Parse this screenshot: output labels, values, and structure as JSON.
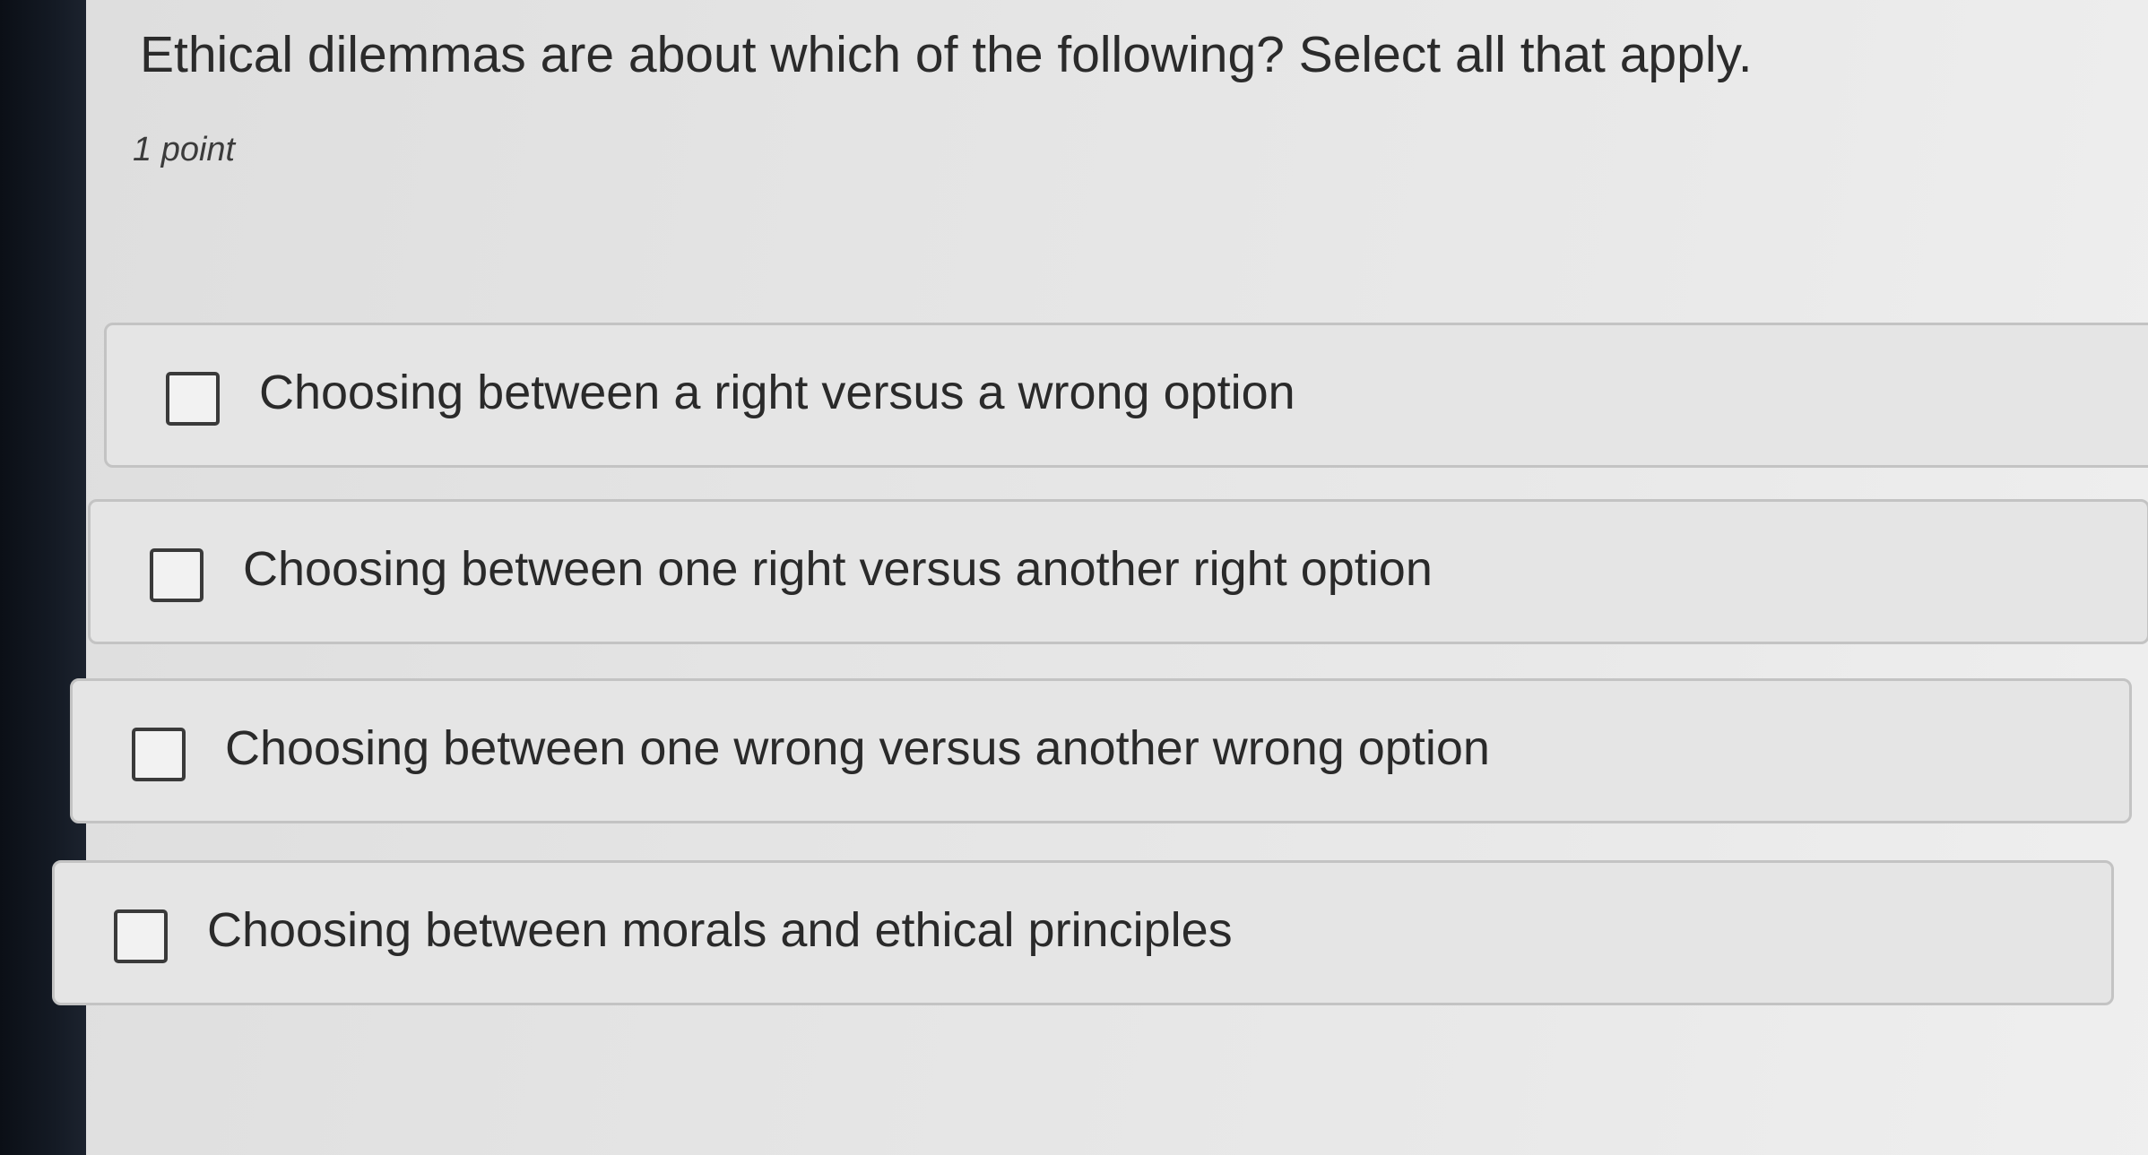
{
  "question": {
    "title": "Ethical dilemmas are about which of the following? Select all that apply.",
    "points": "1 point"
  },
  "options": [
    {
      "label": "Choosing between a right versus a wrong option",
      "checked": false
    },
    {
      "label": "Choosing between one right versus another right option",
      "checked": false
    },
    {
      "label": "Choosing between one wrong versus another wrong option",
      "checked": false
    },
    {
      "label": "Choosing between morals and ethical principles",
      "checked": false
    }
  ]
}
